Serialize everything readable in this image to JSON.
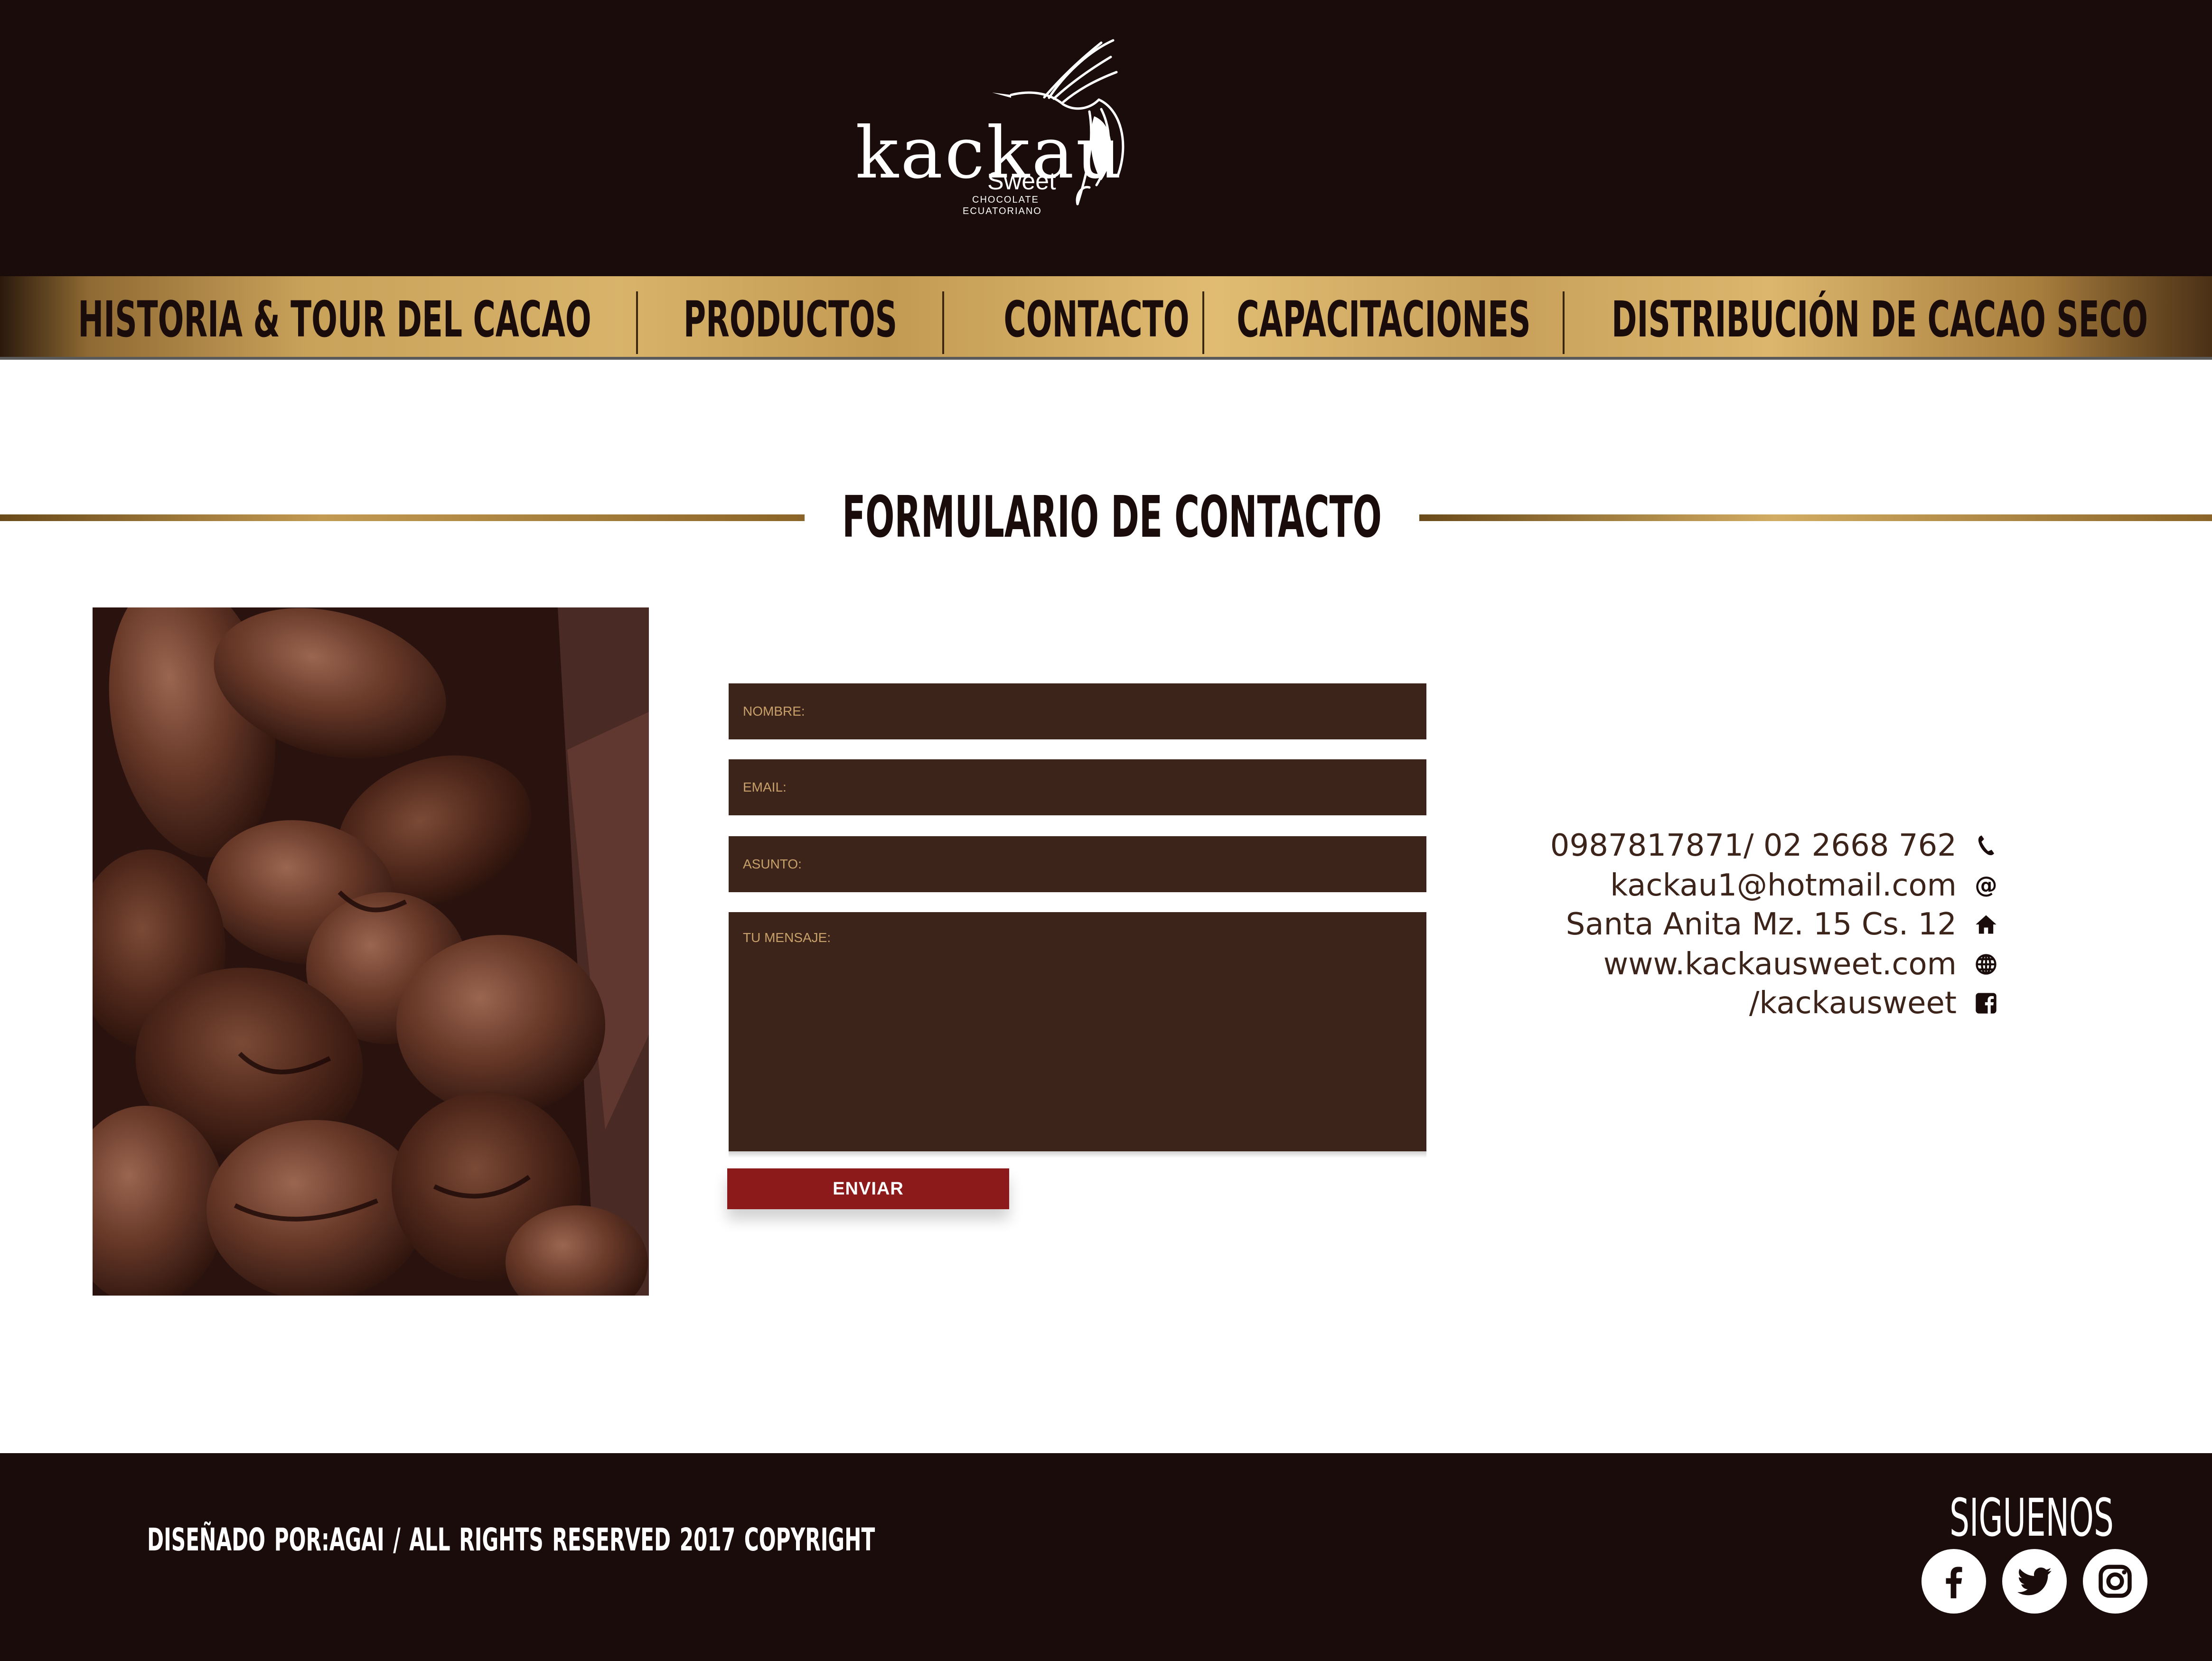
{
  "header": {
    "logo": {
      "name": "kackau",
      "sub": "Sweet",
      "tagline_line1": "CHOCOLATE",
      "tagline_line2": "ECUATORIANO",
      "icon": "hummingbird-logo"
    }
  },
  "nav": {
    "items": [
      {
        "label": "HISTORIA & TOUR DEL CACAO"
      },
      {
        "label": "PRODUCTOS"
      },
      {
        "label": "CONTACTO"
      },
      {
        "label": "CAPACITACIONES"
      },
      {
        "label": "DISTRIBUCIÓN DE CACAO SECO"
      }
    ]
  },
  "main": {
    "title": "FORMULARIO DE CONTACTO",
    "image": "cacao-beans-photo",
    "form": {
      "nombre_placeholder": "NOMBRE:",
      "email_placeholder": "EMAIL:",
      "asunto_placeholder": "ASUNTO:",
      "mensaje_placeholder": "TU MENSAJE:",
      "submit_label": "ENVIAR"
    },
    "contact": {
      "phone": "0987817871/ 02 2668 762",
      "email": "kackau1@hotmail.com",
      "address": "Santa Anita Mz. 15 Cs. 12",
      "website": "www.kackausweet.com",
      "facebook": "/kackausweet",
      "icons": [
        "phone-icon",
        "at-icon",
        "home-icon",
        "globe-icon",
        "facebook-square-icon"
      ]
    }
  },
  "footer": {
    "credit": "DISEÑADO POR:AGAI / ALL RIGHTS RESERVED   2017 COPYRIGHT",
    "follow_label": "SIGUENOS",
    "social": [
      "facebook-icon",
      "twitter-icon",
      "instagram-icon"
    ]
  },
  "colors": {
    "dark_brown": "#1a0c0a",
    "field_brown": "#3c241b",
    "gold": "#c9a25a",
    "button_red": "#8c1a1a"
  }
}
